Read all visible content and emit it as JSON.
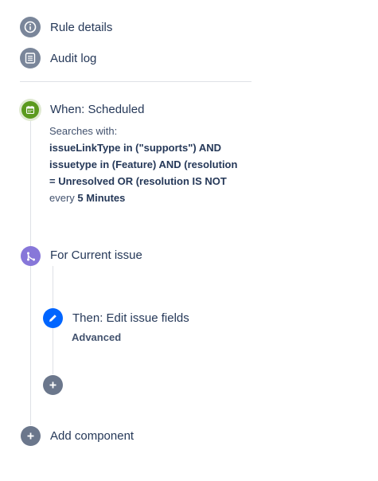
{
  "nav": {
    "rule_details": {
      "label": "Rule details",
      "icon": "info-icon"
    },
    "audit_log": {
      "label": "Audit log",
      "icon": "audit-log-icon"
    }
  },
  "trigger": {
    "title": "When: Scheduled",
    "searches_label": "Searches with:",
    "query_lines": [
      "issueLinkType in (\"supports\") AND",
      "issuetype in (Feature) AND (resolution",
      "= Unresolved OR (resolution IS NOT"
    ],
    "every_label": "every",
    "interval": "5 Minutes",
    "icon": "calendar-icon",
    "color": "#5b9a1e"
  },
  "branch": {
    "title": "For Current issue",
    "icon": "branch-icon",
    "color": "#8777d9"
  },
  "action": {
    "title": "Then: Edit issue fields",
    "subtitle": "Advanced",
    "icon": "pencil-icon",
    "color": "#0065ff"
  },
  "add_inner": {
    "icon": "plus-icon"
  },
  "add_component": {
    "label": "Add component",
    "icon": "plus-icon"
  },
  "colors": {
    "neutral_icon": "#7a869a",
    "line": "#dfe1e6",
    "text": "#253858"
  }
}
